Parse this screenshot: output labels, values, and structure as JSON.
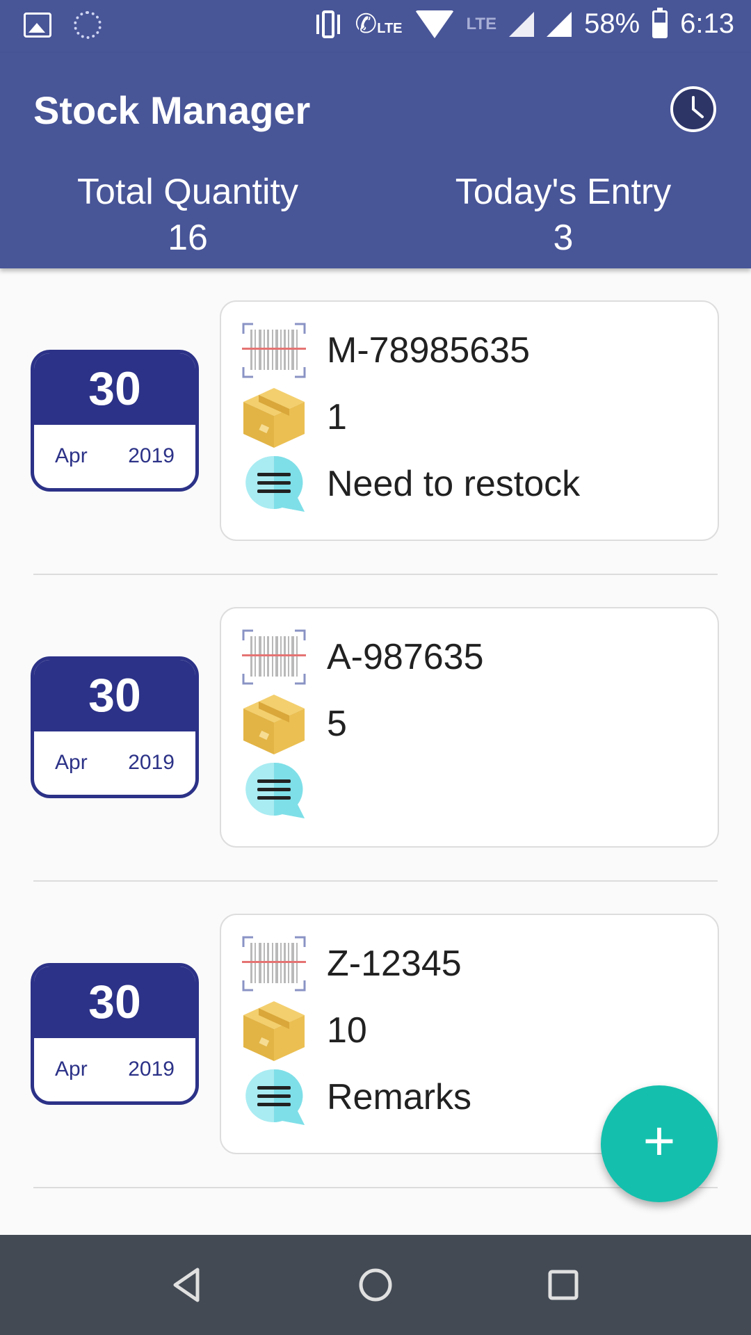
{
  "status_bar": {
    "battery": "58%",
    "time": "6:13",
    "lte_label": "LTE",
    "lte_label2": "LTE"
  },
  "app_bar": {
    "title": "Stock Manager",
    "total_quantity_label": "Total Quantity",
    "total_quantity_value": "16",
    "todays_entry_label": "Today's Entry",
    "todays_entry_value": "3"
  },
  "entries": [
    {
      "day": "30",
      "month": "Apr",
      "year": "2019",
      "code": "M-78985635",
      "quantity": "1",
      "remark": "Need to restock"
    },
    {
      "day": "30",
      "month": "Apr",
      "year": "2019",
      "code": "A-987635",
      "quantity": "5",
      "remark": ""
    },
    {
      "day": "30",
      "month": "Apr",
      "year": "2019",
      "code": "Z-12345",
      "quantity": "10",
      "remark": "Remarks"
    }
  ],
  "fab": {
    "label": "+"
  },
  "colors": {
    "primary": "#485597",
    "date_accent": "#2c3287",
    "fab": "#14C0AD",
    "navbar": "#434a54"
  },
  "icons": {
    "history": "history-icon",
    "barcode": "barcode-icon",
    "quantity": "box-icon",
    "remark": "chat-icon"
  }
}
